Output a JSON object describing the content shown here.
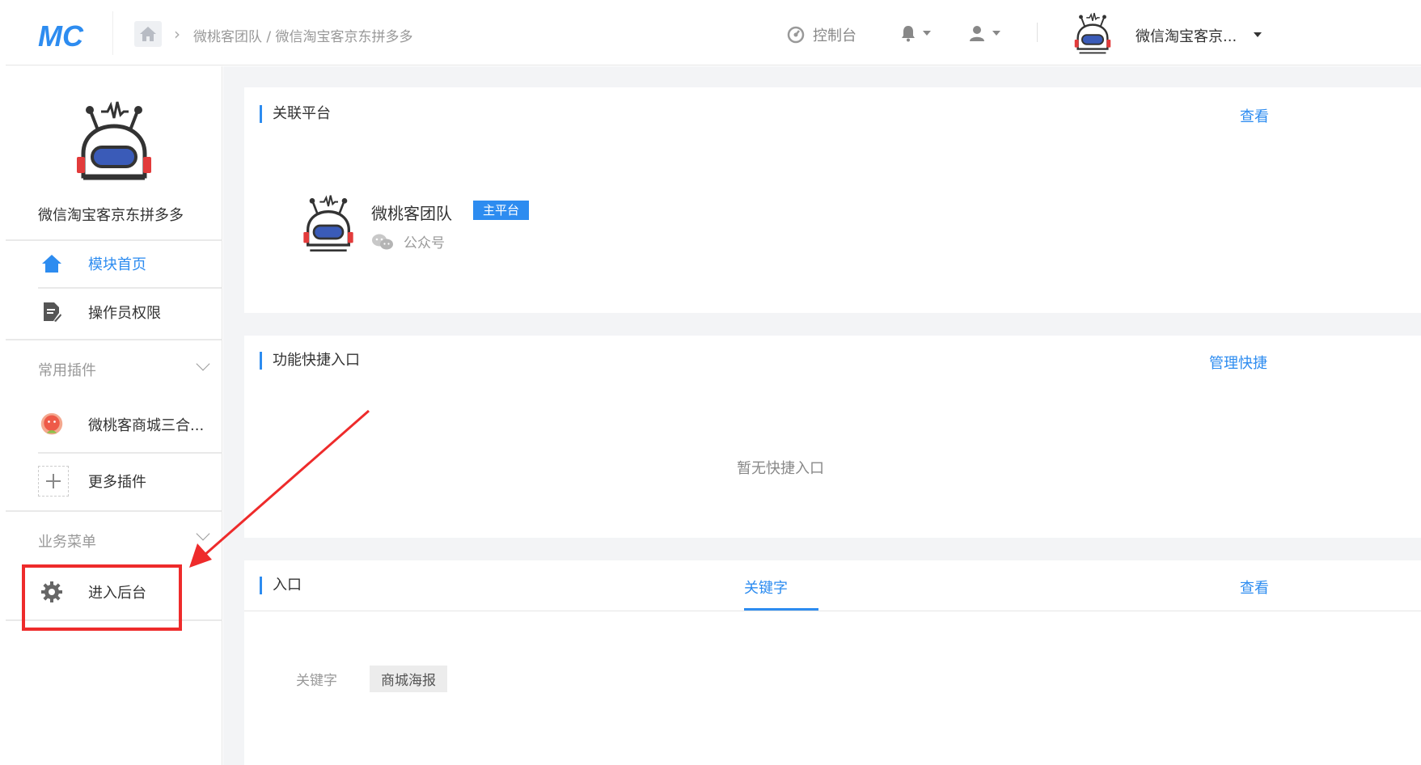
{
  "topbar": {
    "logo_text": "MC",
    "breadcrumb": "微桃客团队 / 微信淘宝客京东拼多多",
    "console_label": "控制台",
    "account_name": "微信淘宝客京..."
  },
  "sidebar": {
    "account_name": "微信淘宝客京东拼多多",
    "nav": [
      {
        "label": "模块首页",
        "icon": "home-icon",
        "active": true
      },
      {
        "label": "操作员权限",
        "icon": "document-edit-icon",
        "active": false
      }
    ],
    "groups": {
      "plugins": {
        "title": "常用插件",
        "items": [
          {
            "label": "微桃客商城三合...",
            "icon": "plugin-app-icon"
          },
          {
            "label": "更多插件",
            "icon": "plus-icon"
          }
        ]
      },
      "business": {
        "title": "业务菜单",
        "items": [
          {
            "label": "进入后台",
            "icon": "gear-icon"
          }
        ]
      }
    }
  },
  "main": {
    "platform_card": {
      "title": "关联平台",
      "link": "查看",
      "platform_name": "微桃客团队",
      "tag": "主平台",
      "type": "公众号"
    },
    "shortcut_card": {
      "title": "功能快捷入口",
      "link": "管理快捷",
      "empty_text": "暂无快捷入口"
    },
    "entry_card": {
      "title": "入口",
      "tab": "关键字",
      "link": "查看",
      "keyword_label": "关键字",
      "keyword_value": "商城海报"
    }
  },
  "colors": {
    "accent": "#2d8cf0",
    "annotation": "#ee2b2b"
  }
}
